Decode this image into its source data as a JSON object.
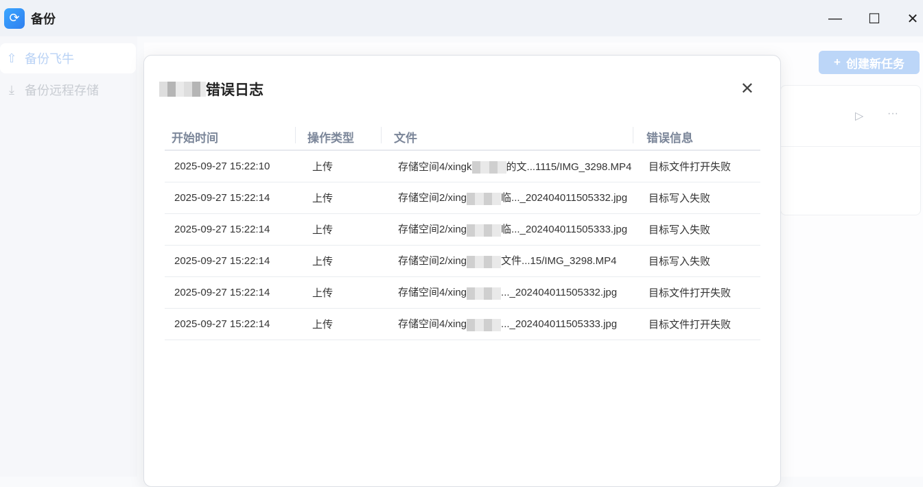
{
  "app": {
    "title": "备份",
    "logo_icon": "sync-icon"
  },
  "window": {
    "minimize": "—",
    "maximize": "☐",
    "close": "✕"
  },
  "sidebar": {
    "items": [
      {
        "label": "备份飞牛",
        "icon": "cloud-upload-icon"
      },
      {
        "label": "备份远程存储",
        "icon": "download-icon"
      }
    ]
  },
  "toolbar": {
    "new_task": "创建新任务",
    "new_icon": "+"
  },
  "card": {
    "play": "▷",
    "more": "···"
  },
  "modal": {
    "title": "错误日志",
    "close": "✕",
    "columns": [
      "开始时间",
      "操作类型",
      "文件",
      "错误信息"
    ],
    "rows": [
      {
        "time": "2025-09-27 15:22:10",
        "op": "上传",
        "file_pre": "存储空间4/xingk",
        "file_post": "的文...1115/IMG_3298.MP4",
        "error": "目标文件打开失败"
      },
      {
        "time": "2025-09-27 15:22:14",
        "op": "上传",
        "file_pre": "存储空间2/xing",
        "file_post": "临..._202404011505332.jpg",
        "error": "目标写入失败"
      },
      {
        "time": "2025-09-27 15:22:14",
        "op": "上传",
        "file_pre": "存储空间2/xing",
        "file_post": "临..._202404011505333.jpg",
        "error": "目标写入失败"
      },
      {
        "time": "2025-09-27 15:22:14",
        "op": "上传",
        "file_pre": "存储空间2/xing",
        "file_post": "文件...15/IMG_3298.MP4",
        "error": "目标写入失败"
      },
      {
        "time": "2025-09-27 15:22:14",
        "op": "上传",
        "file_pre": "存储空间4/xing",
        "file_post": "..._202404011505332.jpg",
        "error": "目标文件打开失败"
      },
      {
        "time": "2025-09-27 15:22:14",
        "op": "上传",
        "file_pre": "存储空间4/xing",
        "file_post": "..._202404011505333.jpg",
        "error": "目标文件打开失败"
      }
    ]
  }
}
